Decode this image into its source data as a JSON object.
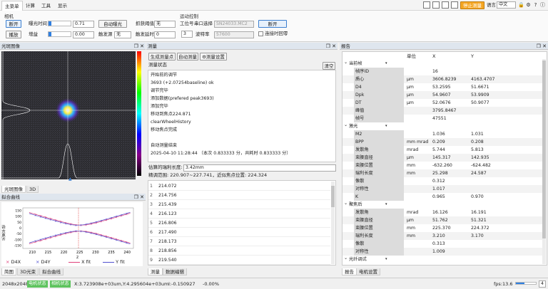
{
  "menubar": {
    "items": [
      "主菜单",
      "计算",
      "工具",
      "显示"
    ],
    "stop_measure": "停止测量",
    "language_label": "语言",
    "language_value": "中文"
  },
  "ribbon": {
    "camera_group": "相机",
    "disconnect": "断开",
    "playback": "播放",
    "exposure_label": "曝光时间",
    "exposure_value": "0.71",
    "gain_label": "增益",
    "gain_value": "0.00",
    "auto_exposure": "自动曝光",
    "trigger_label": "触发源",
    "trigger_value": "无",
    "capture_threshold_label": "抓获阈值",
    "capture_threshold_value": "无",
    "trigger_delay_label": "触发延时",
    "trigger_delay_value": "0",
    "motion_group": "运动控制",
    "station_label": "工位号",
    "station_value": "3",
    "serial_label": "串口选择",
    "serial_value": "SN24033.MC2",
    "baud_label": "波特率",
    "baud_value": "57600",
    "disconnect2": "断开",
    "reconnect_label": "连接时回零"
  },
  "left_panel": {
    "title": "光斑图像",
    "tabs": [
      "光斑图像",
      "3D"
    ],
    "fit_title": "拟合曲线",
    "fit_ylabel": "光束半径",
    "fit_xlabel": "z",
    "fit_xticks": [
      "210",
      "215",
      "220",
      "225",
      "230",
      "235",
      "240"
    ],
    "fit_yticks": [
      "150",
      "100",
      "50",
      "0",
      "-50",
      "-100",
      "-150"
    ],
    "legend": [
      "D4X",
      "D4Y",
      "X fit",
      "Y fit"
    ],
    "bottom_tabs": [
      "简图",
      "3D光束",
      "拟合曲线"
    ]
  },
  "measure_panel": {
    "title": "测量",
    "buttons": [
      "生成测量点",
      "自动测量",
      "测量设置"
    ],
    "status_label": "测量状态",
    "clear": "清空",
    "log": [
      "开始前的调节",
      "3693 (+2.07254baseline)        ok",
      "调节完毕",
      "添加数据(prefered peak3693)",
      "添加完毕",
      "移动到焦点224.871",
      "clearWheelHistory",
      "移动焦点完成",
      "",
      "自动测量结束",
      "2025-04-10 11:28:44 （本次 0.833333 分，共耗时 0.833333 分）"
    ],
    "rayleigh_label": "估算的瑞利长度:",
    "rayleigh_value": "3.42mm",
    "scan_range": "精调范围: 220.907~227.741，近似焦点位置: 224.324",
    "rows": [
      {
        "i": "1",
        "v": "214.072"
      },
      {
        "i": "2",
        "v": "214.756"
      },
      {
        "i": "3",
        "v": "215.439"
      },
      {
        "i": "4",
        "v": "216.123"
      },
      {
        "i": "5",
        "v": "216.806"
      },
      {
        "i": "6",
        "v": "217.490"
      },
      {
        "i": "7",
        "v": "218.173"
      },
      {
        "i": "8",
        "v": "218.856"
      },
      {
        "i": "9",
        "v": "219.540"
      }
    ],
    "bottom_tabs": [
      "测量",
      "数据编辑"
    ]
  },
  "report_panel": {
    "title": "报告",
    "headers": [
      "单位",
      "X",
      "Y"
    ],
    "rows": [
      {
        "name": "当前帧",
        "unit": "",
        "x": "",
        "y": "",
        "section": true
      },
      {
        "name": "帧序ID",
        "unit": "",
        "x": "16",
        "y": ""
      },
      {
        "name": "质心",
        "unit": "μm",
        "x": "3606.8239",
        "y": "4163.4707"
      },
      {
        "name": "D4",
        "unit": "μm",
        "x": "53.2595",
        "y": "51.6671"
      },
      {
        "name": "Dpk",
        "unit": "μm",
        "x": "54.9607",
        "y": "53.9909"
      },
      {
        "name": "DT",
        "unit": "μm",
        "x": "52.0676",
        "y": "50.9077"
      },
      {
        "name": "峰值",
        "unit": "",
        "x": "3795.8467",
        "y": ""
      },
      {
        "name": "帧号",
        "unit": "",
        "x": "47551",
        "y": ""
      },
      {
        "name": "激光",
        "unit": "",
        "x": "",
        "y": "",
        "section": true
      },
      {
        "name": "M2",
        "unit": "",
        "x": "1.036",
        "y": "1.031"
      },
      {
        "name": "BPP",
        "unit": "mm mrad",
        "x": "0.209",
        "y": "0.208"
      },
      {
        "name": "发散角",
        "unit": "mrad",
        "x": "5.744",
        "y": "5.813"
      },
      {
        "name": "束腰直径",
        "unit": "μm",
        "x": "145.317",
        "y": "142.935"
      },
      {
        "name": "束腰位置",
        "unit": "mm",
        "x": "-632.260",
        "y": "-624.482"
      },
      {
        "name": "瑞利长度",
        "unit": "mm",
        "x": "25.298",
        "y": "24.587"
      },
      {
        "name": "像散",
        "unit": "",
        "x": "0.312",
        "y": ""
      },
      {
        "name": "对称性",
        "unit": "",
        "x": "1.017",
        "y": ""
      },
      {
        "name": "K",
        "unit": "",
        "x": "0.965",
        "y": "0.970"
      },
      {
        "name": "聚焦后",
        "unit": "",
        "x": "",
        "y": "",
        "section": true
      },
      {
        "name": "发散角",
        "unit": "mrad",
        "x": "16.126",
        "y": "16.191"
      },
      {
        "name": "束腰直径",
        "unit": "μm",
        "x": "51.762",
        "y": "51.321"
      },
      {
        "name": "束腰位置",
        "unit": "mm",
        "x": "225.370",
        "y": "224.372"
      },
      {
        "name": "瑞利长度",
        "unit": "mm",
        "x": "3.210",
        "y": "3.170"
      },
      {
        "name": "像散",
        "unit": "",
        "x": "0.313",
        "y": ""
      },
      {
        "name": "对称性",
        "unit": "",
        "x": "1.009",
        "y": ""
      },
      {
        "name": "光纤调试",
        "unit": "",
        "x": "",
        "y": "",
        "section": true
      }
    ],
    "bottom_tabs": [
      "报告",
      "电机设置"
    ]
  },
  "statusbar": {
    "resolution": "2048x2048",
    "badge1": "电机状态",
    "badge2": "相机状态",
    "coords": "X:3.723908e+03um,Y:4.295604e+03um",
    "intensity": "I:-0.150927",
    "percent": "-0.00%",
    "fps": "fps:13.6",
    "counter": "4"
  },
  "colors": {
    "accent": "#2f7fe0",
    "stop": "#f5a623",
    "badge": "#5ec35e",
    "fit_x": "#e0407a",
    "fit_y": "#5050d0"
  }
}
